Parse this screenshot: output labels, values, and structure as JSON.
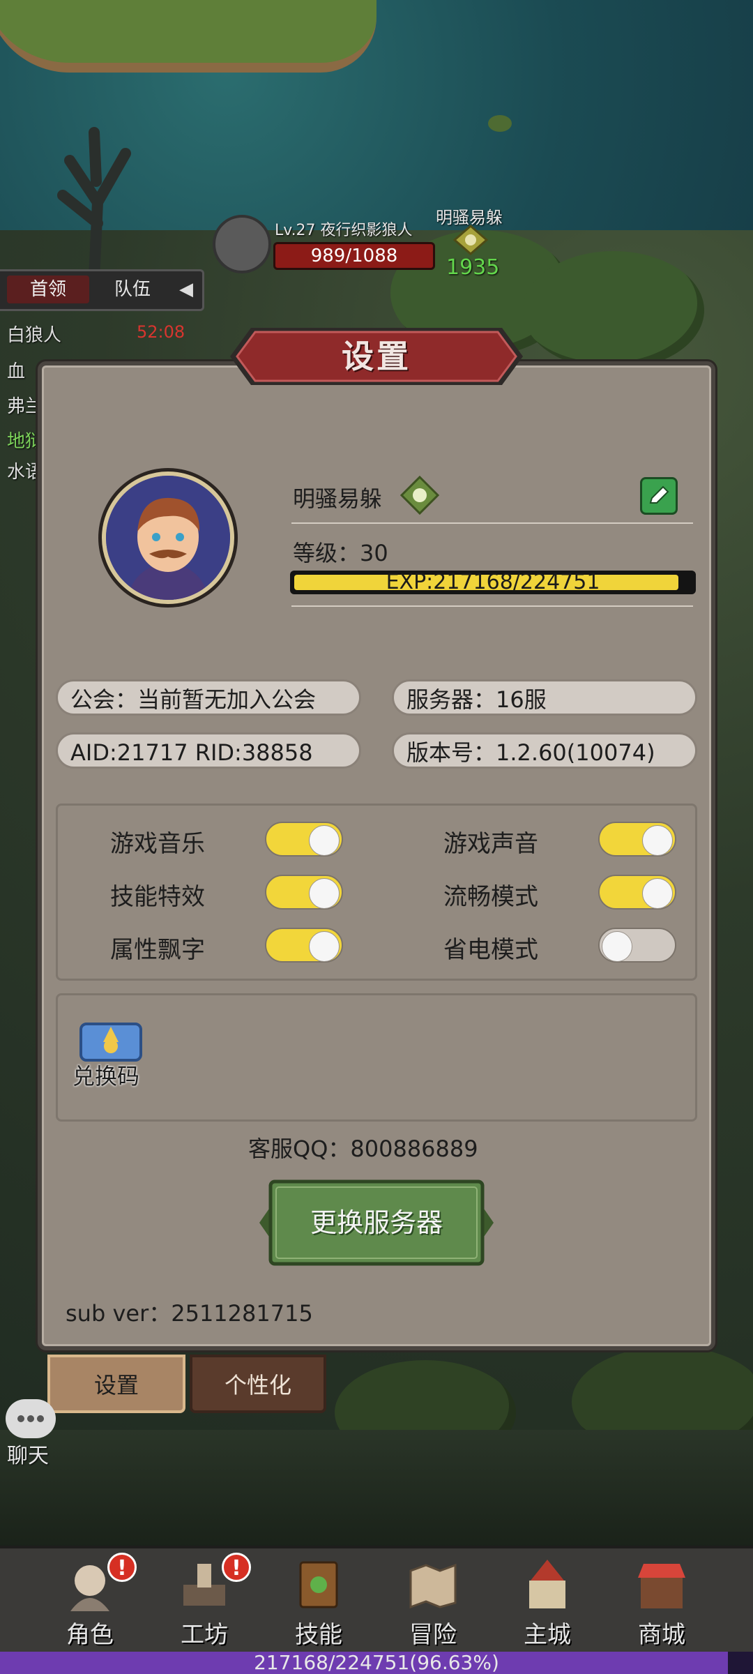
{
  "hud": {
    "enemy_name": "Lv.27 夜行织影狼人",
    "enemy_hp": "989/1088",
    "ally_name": "明骚易躲",
    "ally_score": "1935",
    "side_tabs": [
      "首领",
      "队伍"
    ],
    "side_arrow": "◀",
    "side_rows": [
      "白狼人",
      "血",
      "弗兰",
      "地狱",
      "水语"
    ],
    "side_timer": "52:08"
  },
  "settings": {
    "title": "设置",
    "player_name": "明骚易躲",
    "level": "等级：30",
    "exp_text": "EXP:217168/224751",
    "exp_fraction": 0.9663,
    "guild": "公会：当前暂无加入公会",
    "server": "服务器：16服",
    "ids": "AID:21717  RID:38858",
    "version": "版本号：1.2.60(10074)",
    "toggles": [
      {
        "label": "游戏音乐",
        "on": true
      },
      {
        "label": "游戏声音",
        "on": true
      },
      {
        "label": "技能特效",
        "on": true
      },
      {
        "label": "流畅模式",
        "on": true
      },
      {
        "label": "属性飘字",
        "on": true
      },
      {
        "label": "省电模式",
        "on": false
      }
    ],
    "redeem_label": "兑换码",
    "qq": "客服QQ：800886889",
    "switch_server": "更换服务器",
    "sub_ver": "sub ver：2511281715"
  },
  "panel_tabs": [
    "设置",
    "个性化"
  ],
  "chat_label": "聊天",
  "nav": {
    "items": [
      {
        "label": "角色",
        "alert": true,
        "icon": "character-icon"
      },
      {
        "label": "工坊",
        "alert": true,
        "icon": "workshop-icon"
      },
      {
        "label": "技能",
        "alert": false,
        "icon": "skill-book-icon"
      },
      {
        "label": "冒险",
        "alert": false,
        "icon": "adventure-map-icon"
      },
      {
        "label": "主城",
        "alert": false,
        "icon": "castle-icon"
      },
      {
        "label": "商城",
        "alert": false,
        "icon": "shop-icon"
      }
    ],
    "alert_symbol": "!",
    "progress_text": "217168/224751(96.63%)",
    "progress_fraction": 0.9663
  },
  "colors": {
    "accent_yellow": "#f2d63a",
    "banner_red": "#8f2a2a",
    "button_green": "#5f8a4c"
  }
}
